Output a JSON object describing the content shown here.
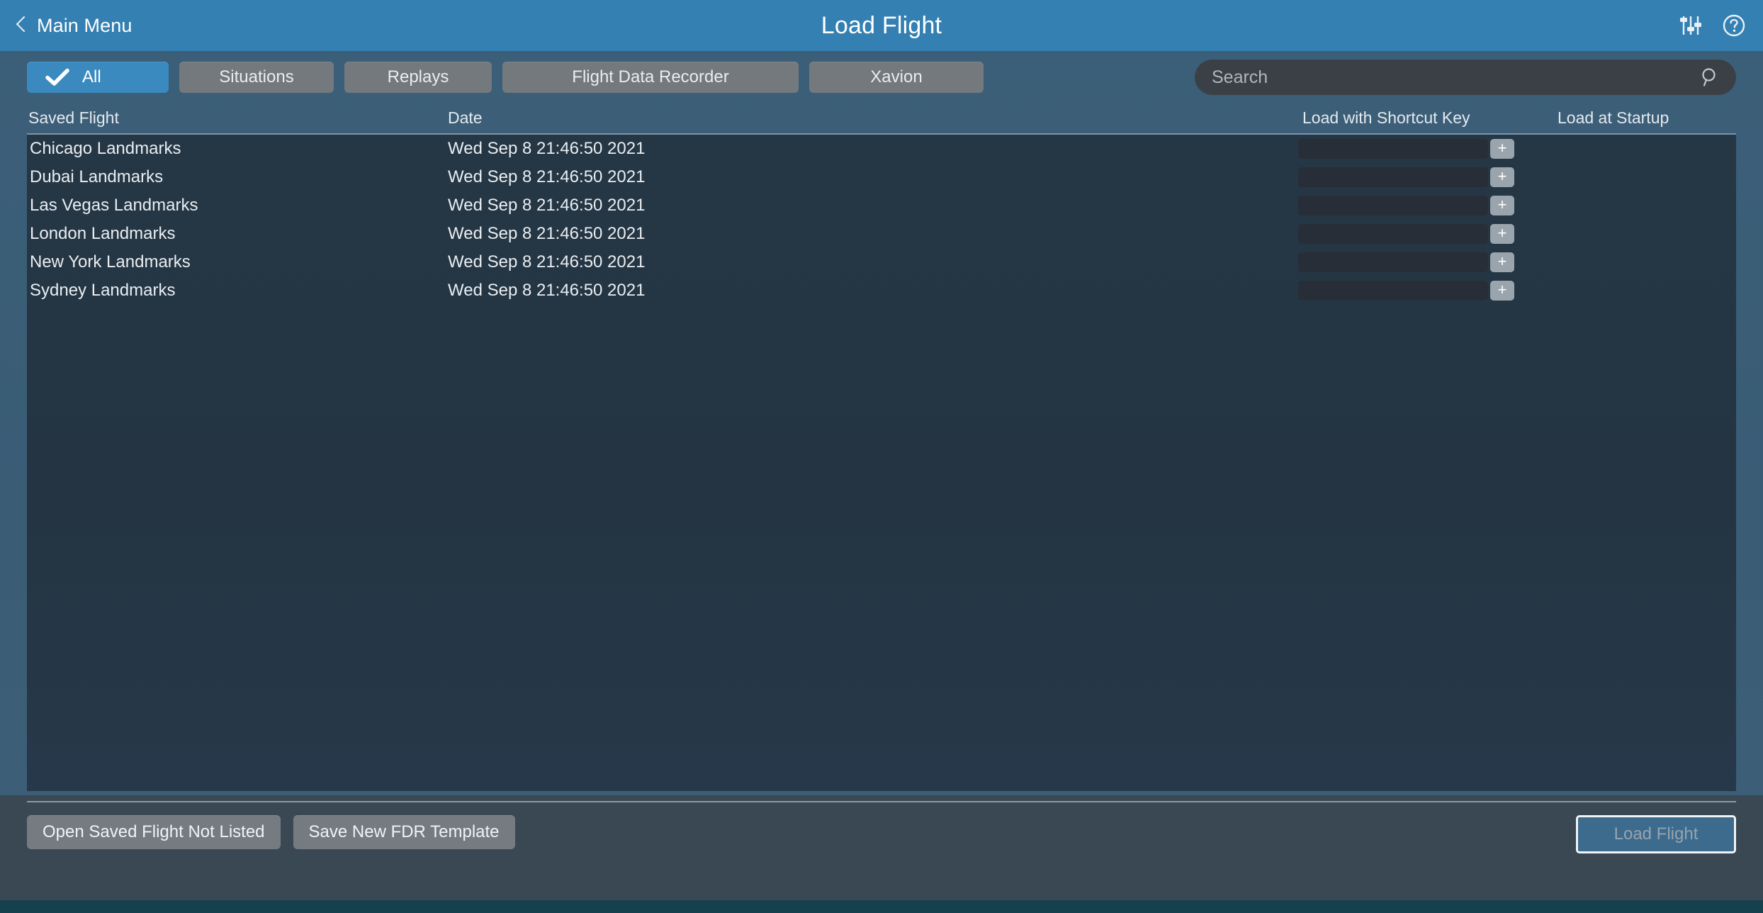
{
  "header": {
    "back_label": "Main Menu",
    "title": "Load Flight",
    "back_icon": "chevron-left-icon",
    "settings_icon": "sliders-icon",
    "help_icon": "help-circle-icon",
    "background_color": "#3480b2"
  },
  "toolbar": {
    "tabs": [
      {
        "label": "All",
        "active": true
      },
      {
        "label": "Situations",
        "active": false
      },
      {
        "label": "Replays",
        "active": false
      },
      {
        "label": "Flight Data Recorder",
        "active": false
      },
      {
        "label": "Xavion",
        "active": false
      }
    ],
    "active_tab_color": "#3a8ac0",
    "inactive_tab_color": "#74797e",
    "check_icon": "check-icon"
  },
  "search": {
    "placeholder": "Search",
    "value": "",
    "icon": "search-icon"
  },
  "table": {
    "columns": [
      "Saved Flight",
      "Date",
      "Load with Shortcut Key",
      "Load at Startup"
    ],
    "rows": [
      {
        "name": "Chicago Landmarks",
        "date": "Wed Sep  8 21:46:50 2021",
        "shortcut_key": "",
        "load_at_startup": false
      },
      {
        "name": "Dubai Landmarks",
        "date": "Wed Sep  8 21:46:50 2021",
        "shortcut_key": "",
        "load_at_startup": false
      },
      {
        "name": "Las Vegas Landmarks",
        "date": "Wed Sep  8 21:46:50 2021",
        "shortcut_key": "",
        "load_at_startup": false
      },
      {
        "name": "London Landmarks",
        "date": "Wed Sep  8 21:46:50 2021",
        "shortcut_key": "",
        "load_at_startup": false
      },
      {
        "name": "New York Landmarks",
        "date": "Wed Sep  8 21:46:50 2021",
        "shortcut_key": "",
        "load_at_startup": false
      },
      {
        "name": "Sydney Landmarks",
        "date": "Wed Sep  8 21:46:50 2021",
        "shortcut_key": "",
        "load_at_startup": false
      }
    ],
    "add_shortcut_label": "+",
    "list_background": "#253745"
  },
  "footer": {
    "open_not_listed_label": "Open Saved Flight Not Listed",
    "save_fdr_template_label": "Save New FDR Template",
    "load_flight_label": "Load Flight",
    "load_flight_enabled": false
  }
}
